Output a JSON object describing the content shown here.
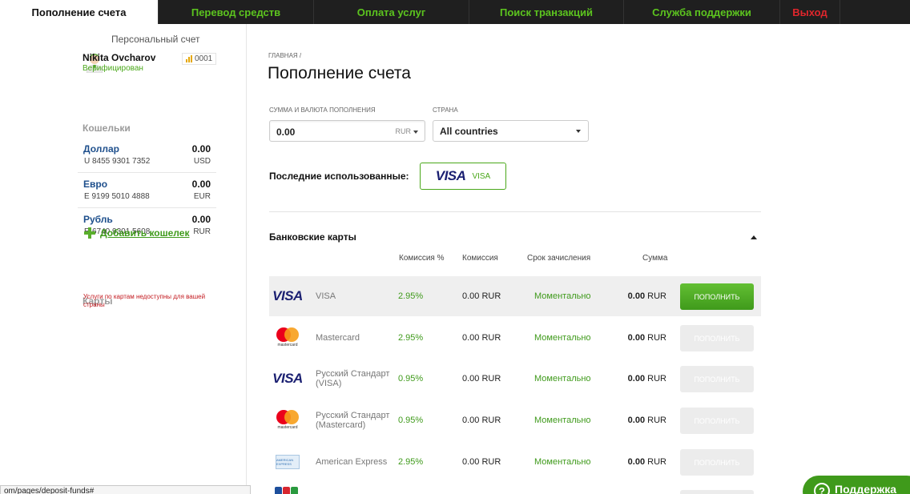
{
  "nav": {
    "tabs": [
      {
        "label": "Пополнение счета",
        "active": true
      },
      {
        "label": "Перевод средств"
      },
      {
        "label": "Оплата услуг"
      },
      {
        "label": "Поиск транзакций"
      },
      {
        "label": "Служба поддержки"
      },
      {
        "label": "Выход"
      }
    ]
  },
  "sidebar": {
    "personal_label": "Персональный счет",
    "user_name": "Nikita Ovcharov",
    "user_level": "0001",
    "user_status": "Верифицирован",
    "wallets_title": "Кошельки",
    "wallets": [
      {
        "name": "Доллар",
        "number": "U 8455 9301 7352",
        "balance": "0.00",
        "currency": "USD"
      },
      {
        "name": "Евро",
        "number": "E 9199 5010 4888",
        "balance": "0.00",
        "currency": "EUR"
      },
      {
        "name": "Рубль",
        "number": "R 6740 9301 5608",
        "balance": "0.00",
        "currency": "RUR"
      }
    ],
    "add_wallet": "Добавить кошелек",
    "cards_title": "Карты",
    "cards_note": "Услуги по картам недоступны для вашей страны"
  },
  "main": {
    "breadcrumb": "ГЛАВНАЯ /",
    "title": "Пополнение счета",
    "amount_label": "СУММА И ВАЛЮТА ПОПОЛНЕНИЯ",
    "amount_value": "0.00",
    "amount_currency": "RUR",
    "country_label": "СТРАНА",
    "country_value": "All countries",
    "recent_label": "Последние использованные:",
    "recent_logo": "VISA",
    "recent_name": "VISA",
    "bank_cards_title": "Банковские карты",
    "columns": {
      "fee_pct": "Комиссия %",
      "fee": "Комиссия",
      "term": "Срок зачисления",
      "sum": "Сумма"
    },
    "rows": [
      {
        "name": "VISA",
        "logo_text": "VISA",
        "fee_pct": "2.95%",
        "fee": "0.00 RUR",
        "term": "Моментально",
        "sum_value": "0.00",
        "sum_currency": "RUR",
        "button": "ПОПОЛНИТЬ"
      },
      {
        "name": "Mastercard",
        "logo_text": "mastercard",
        "fee_pct": "2.95%",
        "fee": "0.00 RUR",
        "term": "Моментально",
        "sum_value": "0.00",
        "sum_currency": "RUR",
        "button": "ПОПОЛНИТЬ"
      },
      {
        "name": "Русский Стандарт (VISA)",
        "logo_text": "VISA",
        "fee_pct": "0.95%",
        "fee": "0.00 RUR",
        "term": "Моментально",
        "sum_value": "0.00",
        "sum_currency": "RUR",
        "button": "ПОПОЛНИТЬ"
      },
      {
        "name": "Русский Стандарт (Mastercard)",
        "logo_text": "mastercard",
        "fee_pct": "0.95%",
        "fee": "0.00 RUR",
        "term": "Моментально",
        "sum_value": "0.00",
        "sum_currency": "RUR",
        "button": "ПОПОЛНИТЬ"
      },
      {
        "name": "American Express",
        "logo_text": "AMERICAN EXPRESS",
        "fee_pct": "2.95%",
        "fee": "0.00 RUR",
        "term": "Моментально",
        "sum_value": "0.00",
        "sum_currency": "RUR",
        "button": "ПОПОЛНИТЬ"
      }
    ]
  },
  "status_url": "om/pages/deposit-funds#",
  "support_label": "Поддержка",
  "colors": {
    "accent": "#5cc41f",
    "primary_button": "#4aa81a",
    "link": "#1e4f8c",
    "danger": "#e0262c"
  }
}
